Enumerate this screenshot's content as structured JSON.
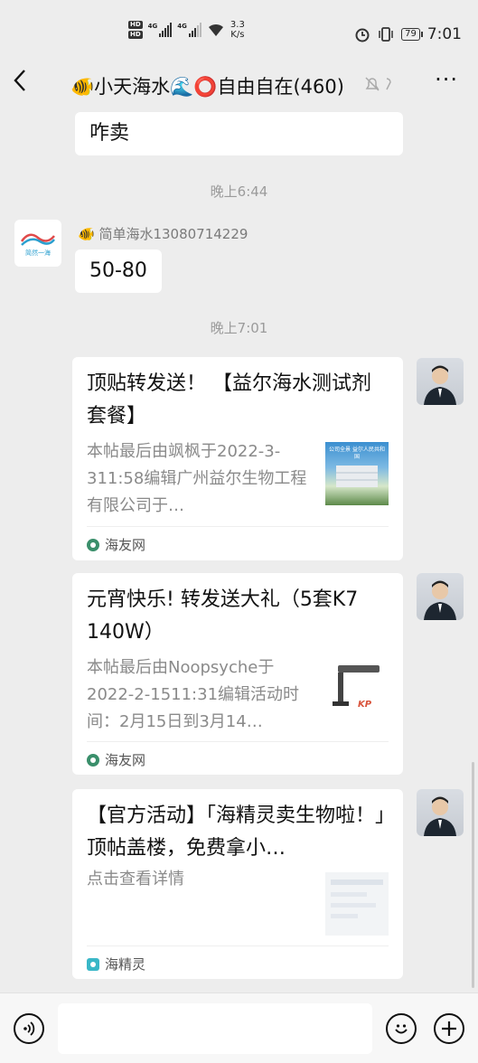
{
  "status_bar": {
    "hd1": "HD",
    "hd2": "HD",
    "net1": "4G",
    "net2": "4G",
    "speed_value": "3.3",
    "speed_unit": "K/s",
    "battery": "79",
    "time": "7:01"
  },
  "nav": {
    "back_label": "‹",
    "title": "🐠小天海水🌊⭕自由自在(460)",
    "mute_icon": "🔕",
    "more_label": "···"
  },
  "messages": {
    "prev_bubble": "咋卖",
    "time1": "晚上6:44",
    "sender_name": "🐠 简单海水13080714229",
    "reply_bubble": "50-80",
    "avatar_logo_text": "简然一海",
    "time2": "晚上7:01",
    "cards": [
      {
        "title": "顶贴转发送！ 【益尔海水测试剂套餐】",
        "desc": "本帖最后由飒枫于2022-3-311:58编辑广州益尔生物工程有限公司于…",
        "thumb_text": "公司全景 益尔人民共和国",
        "source": "海友网"
      },
      {
        "title": "元宵快乐! 转发送大礼（5套K7 140W）",
        "desc": "本帖最后由Noopsyche于2022-2-1511:31编辑活动时间：2月15日到3月14…",
        "thumb_text": "KP",
        "source": "海友网"
      },
      {
        "title": "【官方活动】「海精灵卖生物啦！」顶帖盖楼，免费拿小…",
        "desc": "点击查看详情",
        "thumb_text": "",
        "source": "海精灵"
      }
    ]
  },
  "input_bar": {
    "voice_icon": "🔊",
    "emoji_icon": "☺",
    "plus_icon": "+",
    "input_value": ""
  }
}
